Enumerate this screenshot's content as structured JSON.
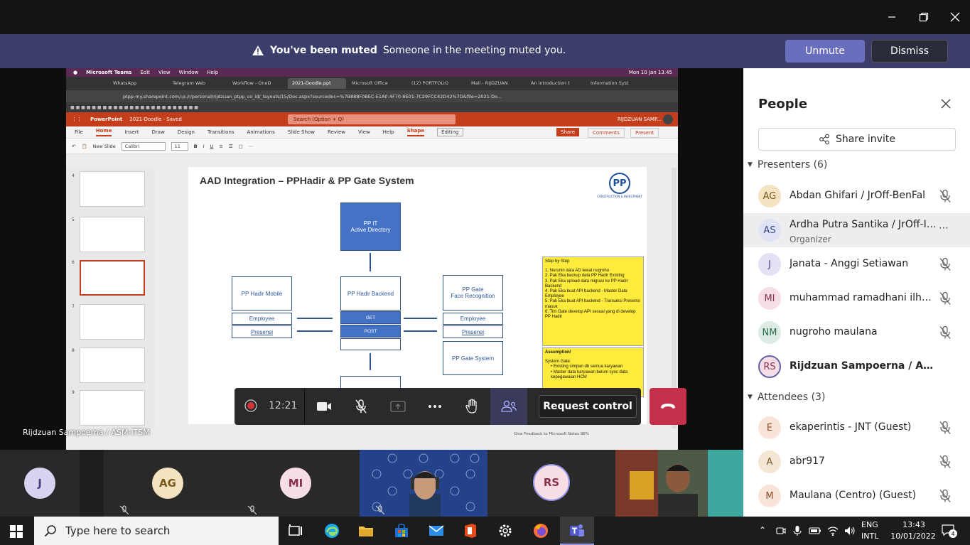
{
  "banner": {
    "title": "You've been muted",
    "message": "Someone in the meeting muted you.",
    "unmute_label": "Unmute",
    "dismiss_label": "Dismiss"
  },
  "shared_screen": {
    "mac_menu": [
      "Microsoft Teams",
      "Edit",
      "View",
      "Window",
      "Help"
    ],
    "mac_clock": "Mon 10 Jan  13.45",
    "browser_tabs": [
      "WhatsApp",
      "Telegram Web",
      "Workflow - OneD",
      "2021-Doodle.ppt",
      "Microsoft Office",
      "(12) PORTFOLIO",
      "Mail - RIJDZUAN",
      "An introduction t",
      "Information Syst"
    ],
    "address": "ptpp-my.sharepoint.com/:p:/r/personal/rijdzuan_ptpp_co_id/_layouts/15/Doc.aspx?sourcedoc=%7B888F0BEC-E1A0-4F70-8E01-7C29FCC42D42%7D&file=2021-Do...",
    "app_name": "PowerPoint",
    "doc_name": "2021-Doodle  -  Saved",
    "search_placeholder": "Search (Option + Q)",
    "user_name": "RIJDZUAN SAMP...",
    "ribbon_tabs": [
      "File",
      "Home",
      "Insert",
      "Draw",
      "Design",
      "Transitions",
      "Animations",
      "Slide Show",
      "Review",
      "View",
      "Help",
      "Shape"
    ],
    "editing_label": "Editing",
    "share_label": "Share",
    "comments_label": "Comments",
    "present_label": "Present",
    "new_slide_label": "New Slide",
    "font_name": "Calibri",
    "font_size": "11",
    "thumb_numbers": [
      "4",
      "5",
      "6",
      "7",
      "8",
      "9"
    ],
    "status_bar": "Give Feedback to Microsoft    Notes                98%"
  },
  "slide": {
    "title": "AAD Integration – PPHadir & PP Gate System",
    "logo_text": "PP",
    "logo_sub": "CONSTRUCTION & INVESTMENT",
    "ad_box_1": "PP IT",
    "ad_box_2": "Active Directory",
    "hadir_mobile": "PP Hadir Mobile",
    "hadir_mobile_emp": "Employee",
    "hadir_mobile_pres": "Presensi",
    "hadir_backend": "PP Hadir Backend",
    "backend_get": "GET",
    "backend_post": "POST",
    "gate_face_1": "PP Gate",
    "gate_face_2": "Face Recognition",
    "gate_emp": "Employee",
    "gate_pres": "Presensi",
    "gate_system": "PP Gate System",
    "note1": [
      "Step by Step",
      "",
      "1. Nurunin data AD lewat nugroho",
      "2. Pak Eka backup data PP Hadir Existing",
      "3. Pak Eka upload data migrasi ke PP Hadir Backend",
      "4. Pak Eka buat API backend - Master Data Employee",
      "5. Pak Eka buat API backend - Transaksi Presensi masuk",
      "6. Tim Gate develop API sesuai yang di develop PP Hadir"
    ],
    "note2_title": "Assumption!",
    "note2_sub": "System Gate:",
    "note2_items": [
      "Existing simpan db semua karyawan",
      "Master data karyawan belum sync data kepegawaian HCM"
    ]
  },
  "presenter_label": "Rijdzuan Sampoerna / ASM-ITSM",
  "controls": {
    "time": "12:21",
    "request_control": "Request control"
  },
  "panel": {
    "title": "People",
    "share_invite": "Share invite",
    "presenters_header": "Presenters (6)",
    "attendees_header": "Attendees (3)",
    "presenters": [
      {
        "initials": "AG",
        "name": "Abdan Ghifari / JrOff-BenFal",
        "role": "",
        "color": "#f4e3c1",
        "fg": "#7a5a1c"
      },
      {
        "initials": "AS",
        "name": "Ardha Putra Santika / JrOff-IT S...",
        "role": "Organizer",
        "color": "#dfe3f5",
        "fg": "#3c4a8a"
      },
      {
        "initials": "J",
        "name": "Janata - Anggi Setiawan",
        "role": "",
        "color": "#e5e0f3",
        "fg": "#4b3f84"
      },
      {
        "initials": "MI",
        "name": "muhammad ramadhani ilham",
        "role": "",
        "color": "#f6dde6",
        "fg": "#8a2f50"
      },
      {
        "initials": "NM",
        "name": "nugroho maulana",
        "role": "",
        "color": "#dcece5",
        "fg": "#2d6a4f"
      },
      {
        "initials": "RS",
        "name": "Rijdzuan Sampoerna / ASM-ITS...",
        "role": "",
        "color": "#f6dde6",
        "fg": "#8a2f50"
      }
    ],
    "attendees": [
      {
        "initials": "E",
        "name": "ekaperintis - JNT (Guest)",
        "color": "#f8e4d8",
        "fg": "#8a4a25"
      },
      {
        "initials": "A",
        "name": "abr917",
        "color": "#f3e6d3",
        "fg": "#7a5a2c"
      },
      {
        "initials": "M",
        "name": "Maulana (Centro) (Guest)",
        "color": "#f8e4d8",
        "fg": "#8a4a25"
      }
    ]
  },
  "gallery": {
    "tiles": [
      {
        "initials": "J",
        "color": "#d7d3f0",
        "fg": "#4b3f84"
      },
      {
        "initials": "AG",
        "color": "#f4e3c1",
        "fg": "#7a5a1c"
      },
      {
        "initials": "MI",
        "color": "#f6dde6",
        "fg": "#8a2f50"
      },
      {
        "initials": "RS",
        "color": "#f6dde6",
        "fg": "#8a2f50"
      }
    ]
  },
  "taskbar": {
    "search_placeholder": "Type here to search",
    "lang_1": "ENG",
    "lang_2": "INTL",
    "time": "13:43",
    "date": "10/01/2022",
    "notif_count": "4"
  }
}
